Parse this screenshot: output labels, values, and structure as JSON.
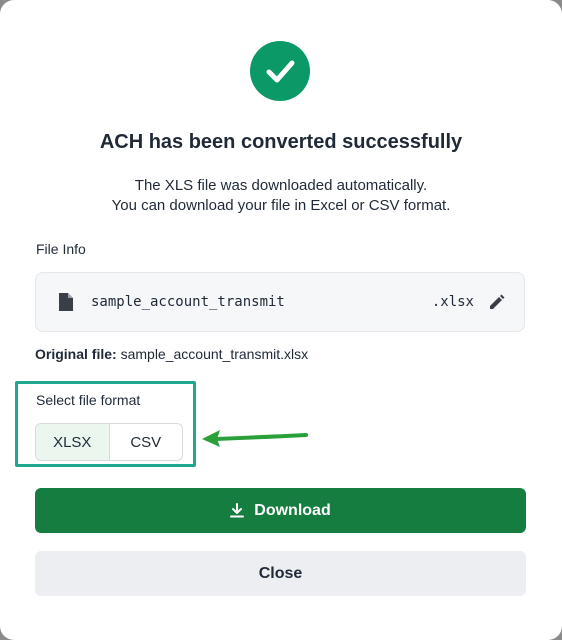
{
  "dialog": {
    "title": "ACH has been converted successfully",
    "subtitle_line1": "The XLS file was downloaded automatically.",
    "subtitle_line2": "You can download your file in Excel or CSV format."
  },
  "file_info": {
    "label": "File Info",
    "file_name": "sample_account_transmit",
    "extension": ".xlsx"
  },
  "original_file": {
    "label": "Original file:",
    "value": "sample_account_transmit.xlsx"
  },
  "format": {
    "label": "Select file format",
    "options": [
      "XLSX",
      "CSV"
    ],
    "selected": "XLSX"
  },
  "buttons": {
    "download": "Download",
    "close": "Close"
  },
  "icons": {
    "success": "check-circle-icon",
    "file": "document-icon",
    "edit": "pencil-icon",
    "download": "download-icon",
    "annotation": "arrow-left-icon"
  },
  "colors": {
    "success": "#0b9968",
    "primary_button": "#167d40",
    "highlight": "#1ea88f",
    "annotation_arrow": "#2aa03a"
  }
}
